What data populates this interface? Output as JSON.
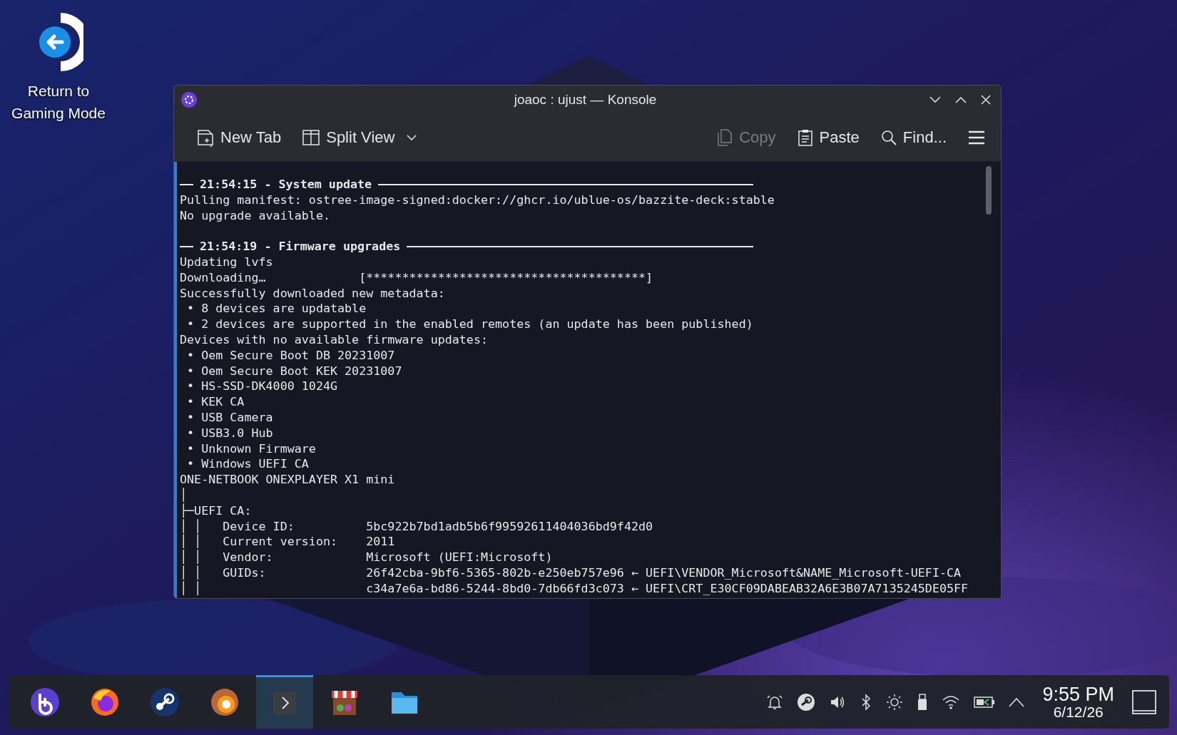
{
  "desktop_icon": {
    "label": "Return to Gaming Mode"
  },
  "window": {
    "title": "joaoc : ujust — Konsole",
    "toolbar": [
      {
        "kind": "new-tab",
        "label": "New Tab",
        "disabled": false
      },
      {
        "kind": "split-view",
        "label": "Split View",
        "disabled": false
      },
      {
        "kind": "copy",
        "label": "Copy",
        "disabled": true
      },
      {
        "kind": "paste",
        "label": "Paste",
        "disabled": false
      },
      {
        "kind": "find",
        "label": "Find...",
        "disabled": false
      }
    ],
    "terminal_lines": [
      {
        "kind": "header",
        "text": "21:54:15 - System update"
      },
      {
        "kind": "text",
        "text": "Pulling manifest: ostree-image-signed:docker://ghcr.io/ublue-os/bazzite-deck:stable"
      },
      {
        "kind": "text",
        "text": "No upgrade available."
      },
      {
        "kind": "blank"
      },
      {
        "kind": "header",
        "text": "21:54:19 - Firmware upgrades"
      },
      {
        "kind": "text",
        "text": "Updating lvfs"
      },
      {
        "kind": "text",
        "text": "Downloading…             [***************************************]"
      },
      {
        "kind": "text",
        "text": "Successfully downloaded new metadata:"
      },
      {
        "kind": "text",
        "text": " • 8 devices are updatable"
      },
      {
        "kind": "text",
        "text": " • 2 devices are supported in the enabled remotes (an update has been published)"
      },
      {
        "kind": "text",
        "text": "Devices with no available firmware updates:"
      },
      {
        "kind": "text",
        "text": " • Oem Secure Boot DB 20231007"
      },
      {
        "kind": "text",
        "text": " • Oem Secure Boot KEK 20231007"
      },
      {
        "kind": "text",
        "text": " • HS-SSD-DK4000 1024G"
      },
      {
        "kind": "text",
        "text": " • KEK CA"
      },
      {
        "kind": "text",
        "text": " • USB Camera"
      },
      {
        "kind": "text",
        "text": " • USB3.0 Hub"
      },
      {
        "kind": "text",
        "text": " • Unknown Firmware"
      },
      {
        "kind": "text",
        "text": " • Windows UEFI CA"
      },
      {
        "kind": "text",
        "text": "ONE-NETBOOK ONEXPLAYER X1 mini"
      },
      {
        "kind": "text",
        "text": "│"
      },
      {
        "kind": "text",
        "text": "├─UEFI CA:"
      },
      {
        "kind": "text",
        "text": "│ │   Device ID:          5bc922b7bd1adb5b6f99592611404036bd9f42d0"
      },
      {
        "kind": "text",
        "text": "│ │   Current version:    2011"
      },
      {
        "kind": "text",
        "text": "│ │   Vendor:             Microsoft (UEFI:Microsoft)"
      },
      {
        "kind": "text",
        "text": "│ │   GUIDs:              26f42cba-9bf6-5365-802b-e250eb757e96 ← UEFI\\VENDOR_Microsoft&NAME_Microsoft-UEFI-CA"
      },
      {
        "kind": "text",
        "text": "│ │                       c34a7e6a-bd86-5244-8bd0-7db66fd3c073 ← UEFI\\CRT_E30CF09DABEAB32A6E3B07A7135245DE05FF"
      }
    ]
  },
  "taskbar": {
    "apps": [
      {
        "selected": false
      },
      {
        "selected": false
      },
      {
        "selected": false
      },
      {
        "selected": false
      },
      {
        "selected": true
      },
      {
        "selected": false
      },
      {
        "selected": false
      }
    ],
    "clock": {
      "time": "9:55 PM",
      "date": "6/12/26"
    }
  }
}
